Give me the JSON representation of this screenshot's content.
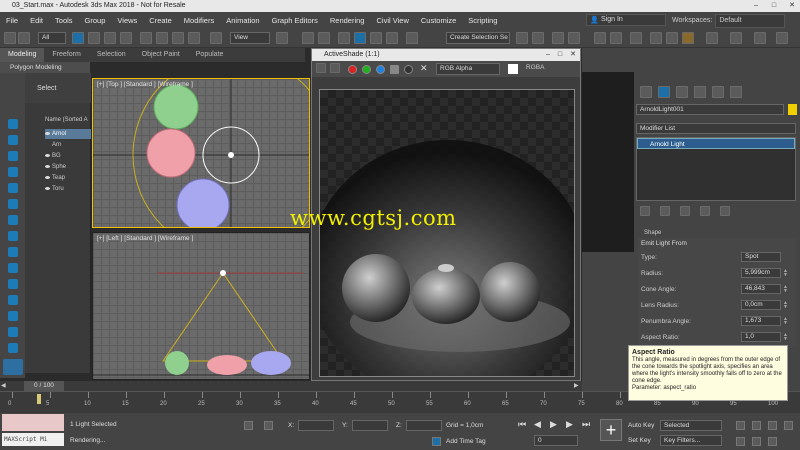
{
  "window": {
    "title": "03_Start.max - Autodesk 3ds Max 2018 - Not for Resale",
    "controls": [
      "–",
      "□",
      "✕"
    ]
  },
  "menu": [
    "File",
    "Edit",
    "Tools",
    "Group",
    "Views",
    "Create",
    "Modifiers",
    "Animation",
    "Graph Editors",
    "Rendering",
    "Civil View",
    "Customize",
    "Scripting"
  ],
  "account": {
    "sign_in": "Sign In",
    "workspaces_label": "Workspaces:",
    "workspace": "Default"
  },
  "toolbar": {
    "filter": "All",
    "view": "View",
    "selection_set": "Create Selection Se"
  },
  "ribbon": {
    "tabs": [
      "Modeling",
      "Freeform",
      "Selection",
      "Object Paint",
      "Populate"
    ],
    "active": "Modeling",
    "sub": "Polygon Modeling"
  },
  "scene_explorer": {
    "select_label": "Select",
    "column": "Name (Sorted A",
    "rows": [
      "Arnol",
      "Arn",
      "BG",
      "Sphe",
      "Teap",
      "Toru"
    ]
  },
  "viewports": {
    "top": "[+] [Top ] [Standard ] [Wireframe ]",
    "left": "[+] [Left ] [Standard ] [Wireframe ]"
  },
  "activeshade": {
    "title": "ActiveShade (1:1)",
    "channel": "RGB Alpha",
    "mode": "RGBA"
  },
  "watermark": "www.cgtsj.com",
  "command_panel": {
    "object_name": "ArnoldLight001",
    "modifier_list": "Modifier List",
    "stack_item": "Arnold Light",
    "section_shape": "Shape",
    "section": "Emit Light From",
    "params": [
      {
        "label": "Type:",
        "value": "Spot"
      },
      {
        "label": "Radius:",
        "value": "5,999cm"
      },
      {
        "label": "Cone Angle:",
        "value": "46,843"
      },
      {
        "label": "Lens Radius:",
        "value": "0,0cm"
      },
      {
        "label": "Penumbra Angle:",
        "value": "1,673"
      },
      {
        "label": "Aspect Ratio:",
        "value": "1,0"
      }
    ]
  },
  "tooltip": {
    "title": "Aspect Ratio",
    "body": "This angle, measured in degrees from the outer edge of the cone towards the spotlight axis, specifies an area where the light's intensity smoothly falls off to zero at the cone edge.",
    "param": "Parameter: aspect_ratio"
  },
  "timeline": {
    "frame": "0 / 100",
    "ticks": [
      "0",
      "5",
      "10",
      "15",
      "20",
      "25",
      "30",
      "35",
      "40",
      "45",
      "50",
      "55",
      "60",
      "65",
      "70",
      "75",
      "80",
      "85",
      "90",
      "95",
      "100"
    ]
  },
  "status": {
    "maxscript": "MAXScript Mi",
    "selected": "1 Light Selected",
    "rendering": "Rendering...",
    "x_label": "X:",
    "y_label": "Y:",
    "z_label": "Z:",
    "grid": "Grid = 1,0cm",
    "add_time_tag": "Add Time Tag",
    "frame_value": "0",
    "auto_key": "Auto Key",
    "set_key": "Set Key",
    "key_mode": "Selected",
    "key_filters": "Key Filters..."
  }
}
